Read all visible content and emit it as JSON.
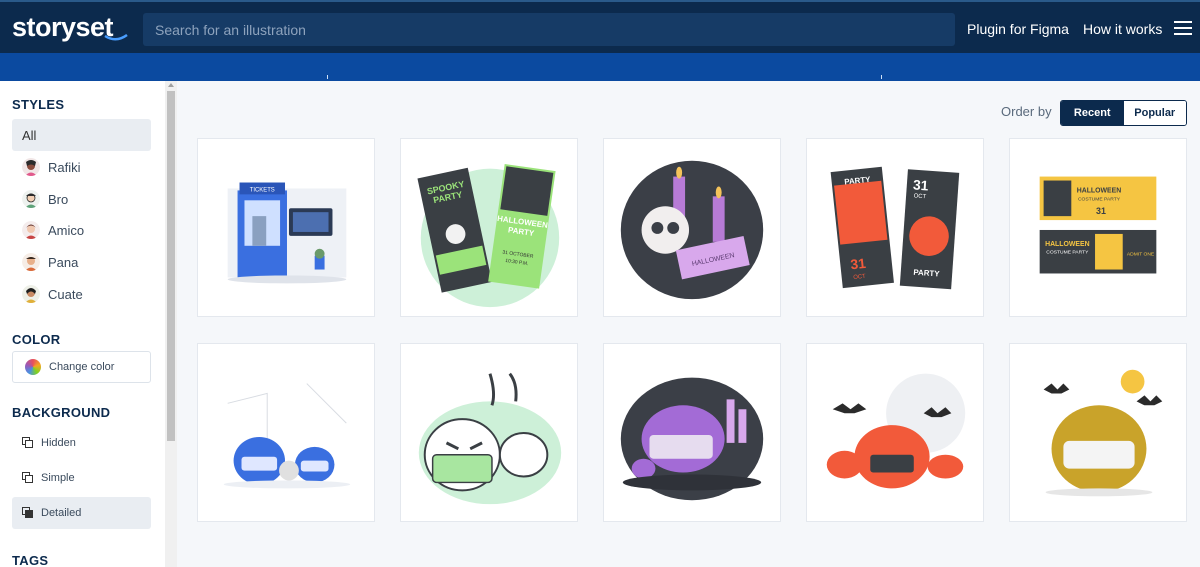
{
  "header": {
    "logo": "storyset",
    "search_placeholder": "Search for an illustration",
    "nav": [
      "Plugin for Figma",
      "How it works"
    ]
  },
  "sidebar": {
    "styles_title": "STYLES",
    "styles": [
      {
        "label": "All",
        "active": true
      },
      {
        "label": "Rafiki",
        "active": false
      },
      {
        "label": "Bro",
        "active": false
      },
      {
        "label": "Amico",
        "active": false
      },
      {
        "label": "Pana",
        "active": false
      },
      {
        "label": "Cuate",
        "active": false
      }
    ],
    "color_title": "COLOR",
    "change_color": "Change color",
    "background_title": "BACKGROUND",
    "backgrounds": [
      {
        "label": "Hidden",
        "active": false
      },
      {
        "label": "Simple",
        "active": false
      },
      {
        "label": "Detailed",
        "active": true
      }
    ],
    "tags_title": "TAGS"
  },
  "main": {
    "order_by": "Order by",
    "order_options": [
      "Recent",
      "Popular"
    ],
    "selected_order": "Recent",
    "cards": [
      {
        "name": "ticket-booth-illustration"
      },
      {
        "name": "spooky-party-tickets-illustration",
        "texts": [
          "SPOOKY PARTY",
          "HALLOWEEN PARTY",
          "31 OCTOBER",
          "10:30 P.M."
        ]
      },
      {
        "name": "skull-candles-tickets-illustration",
        "texts": [
          "HALLOWEEN"
        ]
      },
      {
        "name": "halloween-party-tickets-illustration",
        "texts": [
          "31",
          "OCT",
          "PARTY",
          "LIVE"
        ]
      },
      {
        "name": "halloween-costume-party-tickets-illustration",
        "texts": [
          "HALLOWEEN",
          "COSTUME PARTY",
          "ADMIT ONE",
          "31"
        ]
      },
      {
        "name": "pumpkins-with-masks-blue-illustration"
      },
      {
        "name": "pumpkin-mask-green-illustration"
      },
      {
        "name": "purple-pumpkin-mask-illustration"
      },
      {
        "name": "orange-pumpkins-bats-illustration"
      },
      {
        "name": "yellow-pumpkin-mask-moon-illustration"
      }
    ]
  },
  "colors": {
    "topbar": "#0c2a4d",
    "band": "#0b4aa0",
    "accent": "#0c2a4d"
  }
}
